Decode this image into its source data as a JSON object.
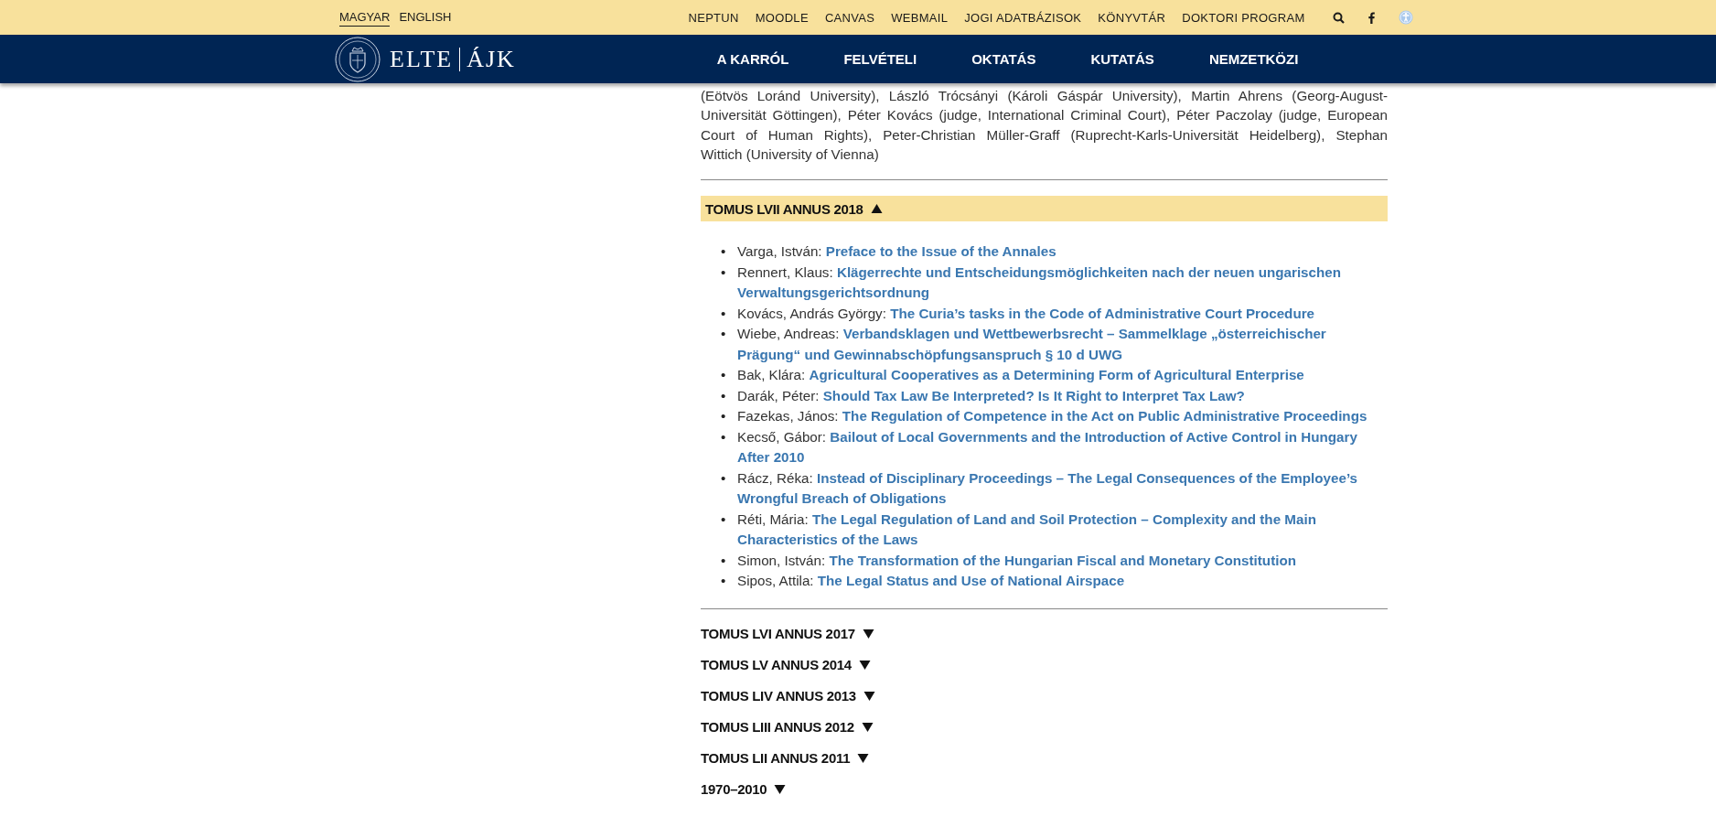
{
  "top_bar": {
    "languages": [
      {
        "label": "MAGYAR",
        "selected": true
      },
      {
        "label": "ENGLISH",
        "selected": false
      }
    ],
    "links": [
      "NEPTUN",
      "MOODLE",
      "CANVAS",
      "WEBMAIL",
      "JOGI ADATBÁZISOK",
      "KÖNYVTÁR",
      "DOKTORI PROGRAM"
    ]
  },
  "header": {
    "logo": {
      "left": "ELTE",
      "right": "ÁJK"
    },
    "nav": [
      "A KARRÓL",
      "FELVÉTELI",
      "OKTATÁS",
      "KUTATÁS",
      "NEMZETKÖZI"
    ]
  },
  "intro_lines": [
    "(Eötvös Loránd University), László Trócsányi (Károli Gáspár University), Martin Ahrens (Georg-August-",
    "Universität Göttingen), Péter Kovács (judge, International Criminal Court), Péter Paczolay (judge, European",
    "Court of Human Rights), Peter-Christian Müller-Graff (Ruprecht-Karls-Universität Heidelberg), Stephan",
    "Wittich (University of Vienna)"
  ],
  "sections": [
    {
      "title": "TOMUS LVII ANNUS 2018",
      "expanded": true,
      "articles": [
        {
          "marker": "•",
          "author": "Varga, István:",
          "title": "Preface to the Issue of the Annales"
        },
        {
          "marker": "•",
          "author": "Rennert, Klaus:",
          "title": "Klägerrechte und Entscheidungsmöglichkeiten nach der neuen ungarischen Verwaltungsgerichtsordnung"
        },
        {
          "marker": "•",
          "author": "Kovács, András György:",
          "title": "The Curia’s tasks in the Code of Administrative Court Procedure"
        },
        {
          "marker": "•",
          "author": "Wiebe, Andreas:",
          "title": "Verbandsklagen und Wettbewerbsrecht – Sammelklage „österreichischer Prägung“ und Gewinnabschöpfungsanspruch § 10 d UWG"
        },
        {
          "marker": "•",
          "author": "Bak, Klára:",
          "title": "Agricultural Cooperatives as a Determining Form of Agricultural Enterprise"
        },
        {
          "marker": "•",
          "author": "Darák, Péter:",
          "title": "Should Tax Law Be Interpreted? Is It Right to Interpret Tax Law?"
        },
        {
          "marker": "•",
          "author": "Fazekas, János:",
          "title": "The Regulation of Competence in the Act on Public Administrative Proceedings"
        },
        {
          "marker": "•",
          "author": "Kecső, Gábor:",
          "title": "Bailout of Local Governments and the Introduction of Active Control in Hungary After 2010"
        },
        {
          "marker": "•",
          "author": "Rácz, Réka:",
          "title": "Instead of Disciplinary Proceedings – The Legal Consequences of the Employee’s Wrongful Breach of Obligations"
        },
        {
          "marker": "•",
          "author": "Réti, Mária:",
          "title": "The Legal Regulation of Land and Soil Protection – Complexity and the Main Characteristics of the Laws"
        },
        {
          "marker": "•",
          "author": "Simon, István:",
          "title": "The Transformation of the Hungarian Fiscal and Monetary Constitution"
        },
        {
          "marker": "•",
          "author": "Sipos, Attila:",
          "title": "The Legal Status and Use of National Airspace"
        }
      ]
    },
    {
      "title": "TOMUS LVI ANNUS 2017",
      "expanded": false
    },
    {
      "title": "TOMUS LV ANNUS 2014",
      "expanded": false
    },
    {
      "title": "TOMUS LIV ANNUS 2013",
      "expanded": false
    },
    {
      "title": "TOMUS LIII ANNUS 2012",
      "expanded": false
    },
    {
      "title": "TOMUS LII ANNUS 2011",
      "expanded": false
    },
    {
      "title": "1970–2010",
      "expanded": false
    }
  ]
}
